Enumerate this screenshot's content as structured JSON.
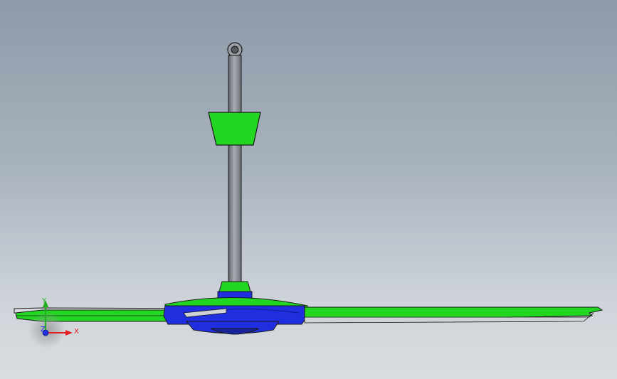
{
  "viewport": {
    "background_top": "#8e9aa8",
    "background_bottom": "#d9dde1"
  },
  "model": {
    "colors": {
      "rod": "#8f949b",
      "rod_dark": "#5f646b",
      "green_part": "#22d622",
      "blue_part": "#1f2fe0",
      "outline": "#1a1a1a"
    }
  },
  "triad": {
    "x_label": "X",
    "y_label": "Y",
    "z_label": "Z",
    "x_color": "#e02020",
    "y_color": "#20b020",
    "z_color": "#2030e0"
  }
}
